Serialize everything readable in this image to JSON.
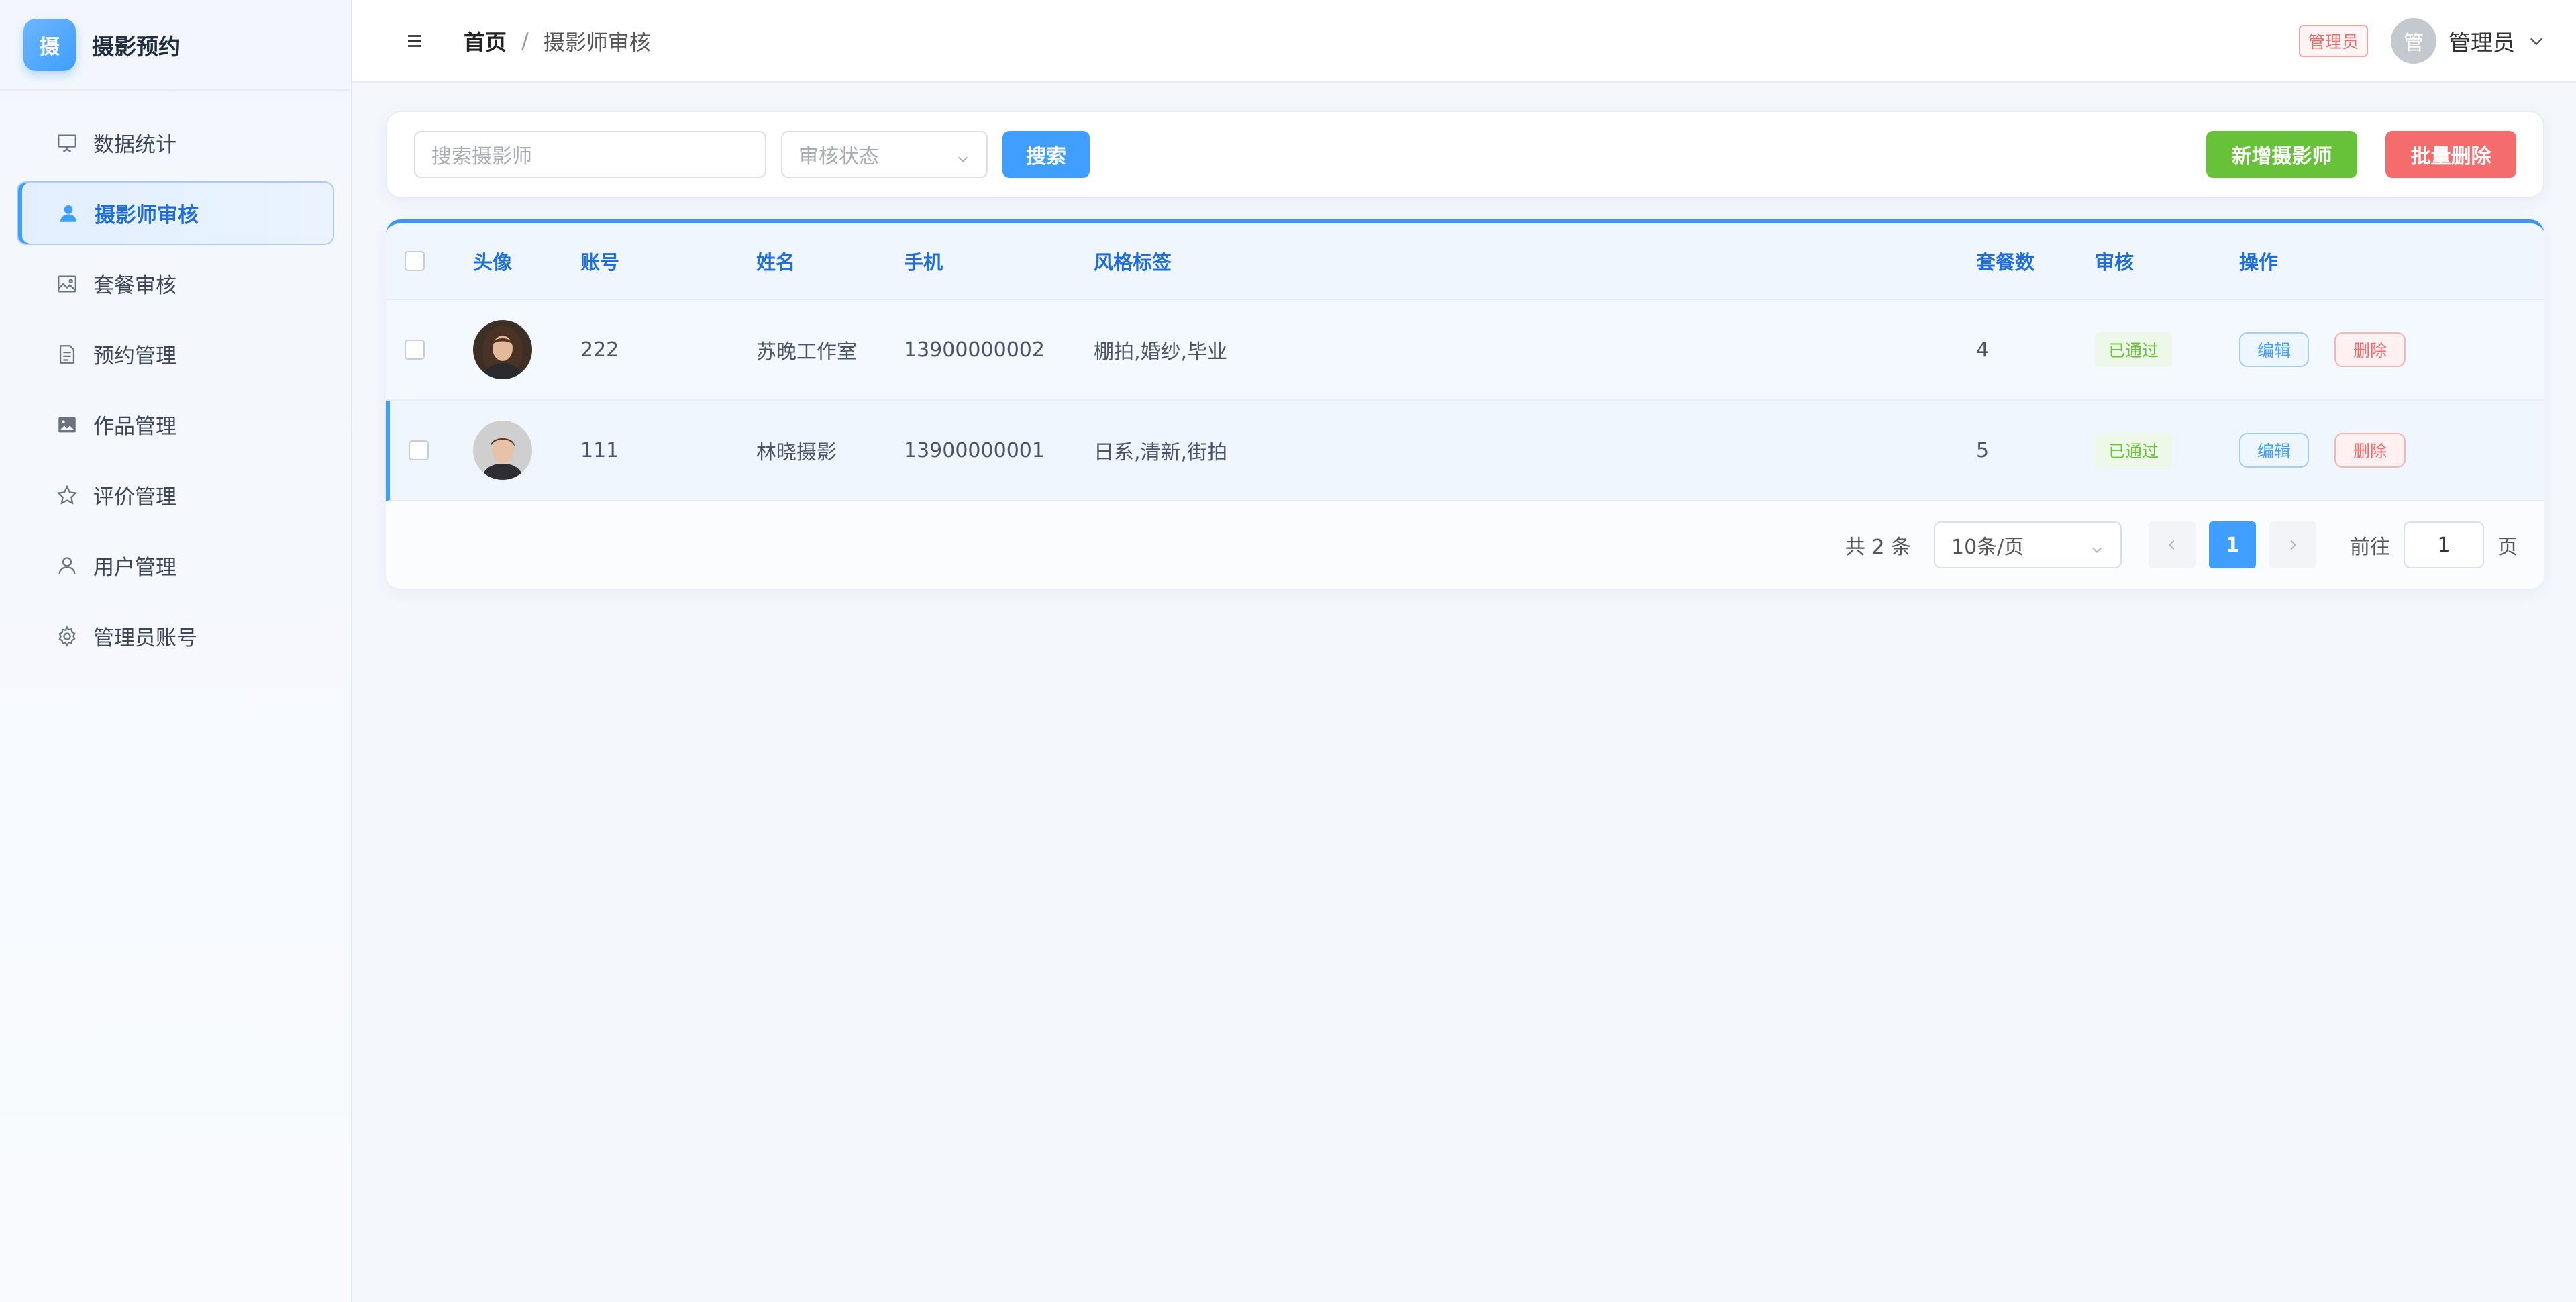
{
  "brand": {
    "logo_char": "摄",
    "name": "摄影预约"
  },
  "sidebar": {
    "items": [
      {
        "label": "数据统计",
        "icon": "presentation-board-icon",
        "active": false
      },
      {
        "label": "摄影师审核",
        "icon": "user-filled-icon",
        "active": true
      },
      {
        "label": "套餐审核",
        "icon": "picture-icon",
        "active": false
      },
      {
        "label": "预约管理",
        "icon": "document-icon",
        "active": false
      },
      {
        "label": "作品管理",
        "icon": "picture-filled-icon",
        "active": false
      },
      {
        "label": "评价管理",
        "icon": "star-icon",
        "active": false
      },
      {
        "label": "用户管理",
        "icon": "user-icon",
        "active": false
      },
      {
        "label": "管理员账号",
        "icon": "gear-icon",
        "active": false
      }
    ]
  },
  "header": {
    "breadcrumb": {
      "home": "首页",
      "separator": "/",
      "current": "摄影师审核"
    },
    "role_tag": "管理员",
    "avatar_char": "管",
    "user_name": "管理员"
  },
  "search": {
    "keyword_placeholder": "搜索摄影师",
    "status_placeholder": "审核状态",
    "search_label": "搜索",
    "add_label": "新增摄影师",
    "batch_delete_label": "批量删除"
  },
  "table": {
    "columns": [
      "头像",
      "账号",
      "姓名",
      "手机",
      "风格标签",
      "套餐数",
      "审核",
      "操作"
    ],
    "rows": [
      {
        "account": "222",
        "name": "苏晚工作室",
        "phone": "13900000002",
        "tags": "棚拍,婚纱,毕业",
        "package_count": "4",
        "audit": "已通过",
        "edit": "编辑",
        "delete": "删除"
      },
      {
        "account": "111",
        "name": "林晓摄影",
        "phone": "13900000001",
        "tags": "日系,清新,街拍",
        "package_count": "5",
        "audit": "已通过",
        "edit": "编辑",
        "delete": "删除"
      }
    ]
  },
  "pagination": {
    "total_text": "共 2 条",
    "page_size": "10条/页",
    "current_page": "1",
    "goto_label": "前往",
    "goto_value": "1",
    "page_suffix": "页"
  },
  "colors": {
    "primary": "#409eff",
    "success": "#67c23a",
    "danger": "#f56c6c"
  }
}
